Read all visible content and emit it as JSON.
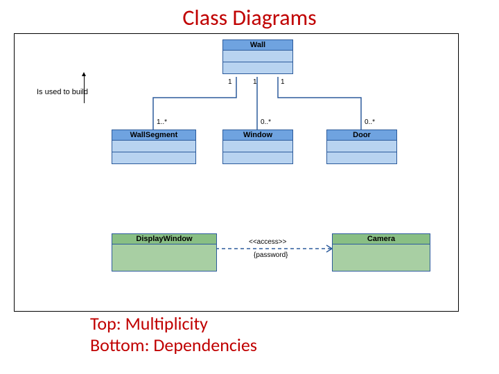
{
  "title": "Class Diagrams",
  "caption_line1": "Top: Multiplicity",
  "caption_line2": "Bottom: Dependencies",
  "side_note": "Is used to build",
  "classes": {
    "wall": "Wall",
    "wallSegment": "WallSegment",
    "window": "Window",
    "door": "Door",
    "displayWindow": "DisplayWindow",
    "camera": "Camera"
  },
  "mult": {
    "wall_seg_top": "1",
    "wall_seg_bot": "1..*",
    "wall_win_top": "1",
    "wall_win_bot": "0..*",
    "wall_door_top": "1",
    "wall_door_bot": "0..*"
  },
  "dep": {
    "stereo": "<<access>>",
    "constraint": "{password}"
  }
}
